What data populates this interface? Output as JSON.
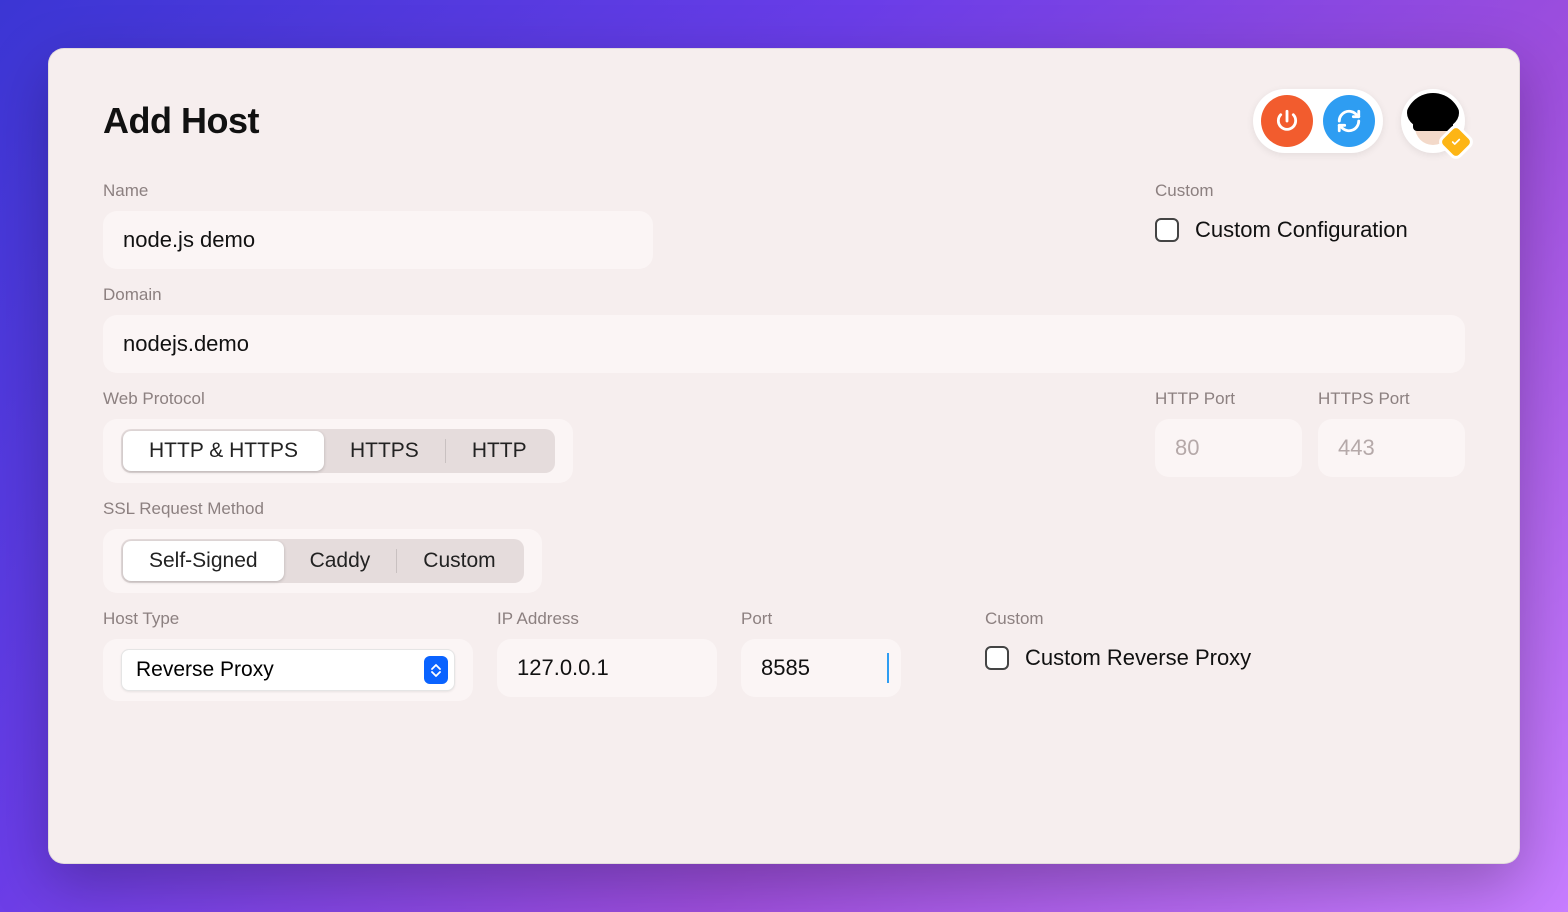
{
  "title": "Add Host",
  "header": {
    "power_button": "power",
    "refresh_button": "refresh"
  },
  "name": {
    "label": "Name",
    "value": "node.js demo"
  },
  "custom_config": {
    "label": "Custom",
    "checkbox_label": "Custom Configuration",
    "checked": false
  },
  "domain": {
    "label": "Domain",
    "value": "nodejs.demo"
  },
  "web_protocol": {
    "label": "Web Protocol",
    "options": [
      "HTTP & HTTPS",
      "HTTPS",
      "HTTP"
    ],
    "selected": "HTTP & HTTPS"
  },
  "http_port": {
    "label": "HTTP Port",
    "placeholder": "80",
    "value": ""
  },
  "https_port": {
    "label": "HTTPS Port",
    "placeholder": "443",
    "value": ""
  },
  "ssl_method": {
    "label": "SSL Request Method",
    "options": [
      "Self-Signed",
      "Caddy",
      "Custom"
    ],
    "selected": "Self-Signed"
  },
  "host_type": {
    "label": "Host Type",
    "value": "Reverse Proxy"
  },
  "ip_address": {
    "label": "IP Address",
    "value": "127.0.0.1"
  },
  "port": {
    "label": "Port",
    "value": "8585"
  },
  "custom_reverse": {
    "label": "Custom",
    "checkbox_label": "Custom Reverse Proxy",
    "checked": false
  }
}
